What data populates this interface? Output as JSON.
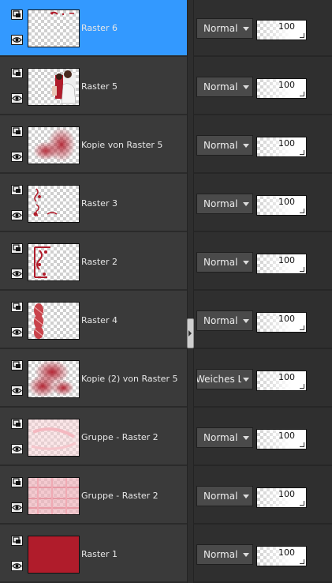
{
  "layers": [
    {
      "name": "Raster 6",
      "blend_mode": "Normal",
      "opacity": "100",
      "selected": true,
      "thumb": "raster6"
    },
    {
      "name": "Raster 5",
      "blend_mode": "Normal",
      "opacity": "100",
      "selected": false,
      "thumb": "raster5"
    },
    {
      "name": "Kopie von Raster 5",
      "blend_mode": "Normal",
      "opacity": "100",
      "selected": false,
      "thumb": "kopie5"
    },
    {
      "name": "Raster 3",
      "blend_mode": "Normal",
      "opacity": "100",
      "selected": false,
      "thumb": "raster3"
    },
    {
      "name": "Raster 2",
      "blend_mode": "Normal",
      "opacity": "100",
      "selected": false,
      "thumb": "raster2"
    },
    {
      "name": "Raster 4",
      "blend_mode": "Normal",
      "opacity": "100",
      "selected": false,
      "thumb": "raster4"
    },
    {
      "name": "Kopie (2) von Raster 5",
      "blend_mode": "Weiches Licht",
      "opacity": "100",
      "selected": false,
      "thumb": "kopie2"
    },
    {
      "name": "Gruppe - Raster 2",
      "blend_mode": "Normal",
      "opacity": "100",
      "selected": false,
      "thumb": "gruppe1"
    },
    {
      "name": "Gruppe - Raster 2",
      "blend_mode": "Normal",
      "opacity": "100",
      "selected": false,
      "thumb": "gruppe2"
    },
    {
      "name": "Raster 1",
      "blend_mode": "Normal",
      "opacity": "100",
      "selected": false,
      "thumb": "solid"
    }
  ],
  "icons": {
    "top": "layer-type-icon",
    "bottom": "visibility-eye-icon"
  },
  "colors": {
    "selected_row": "#3399ff",
    "panel_bg": "#3a3a3a",
    "raster1_fill": "#b01c2b"
  }
}
